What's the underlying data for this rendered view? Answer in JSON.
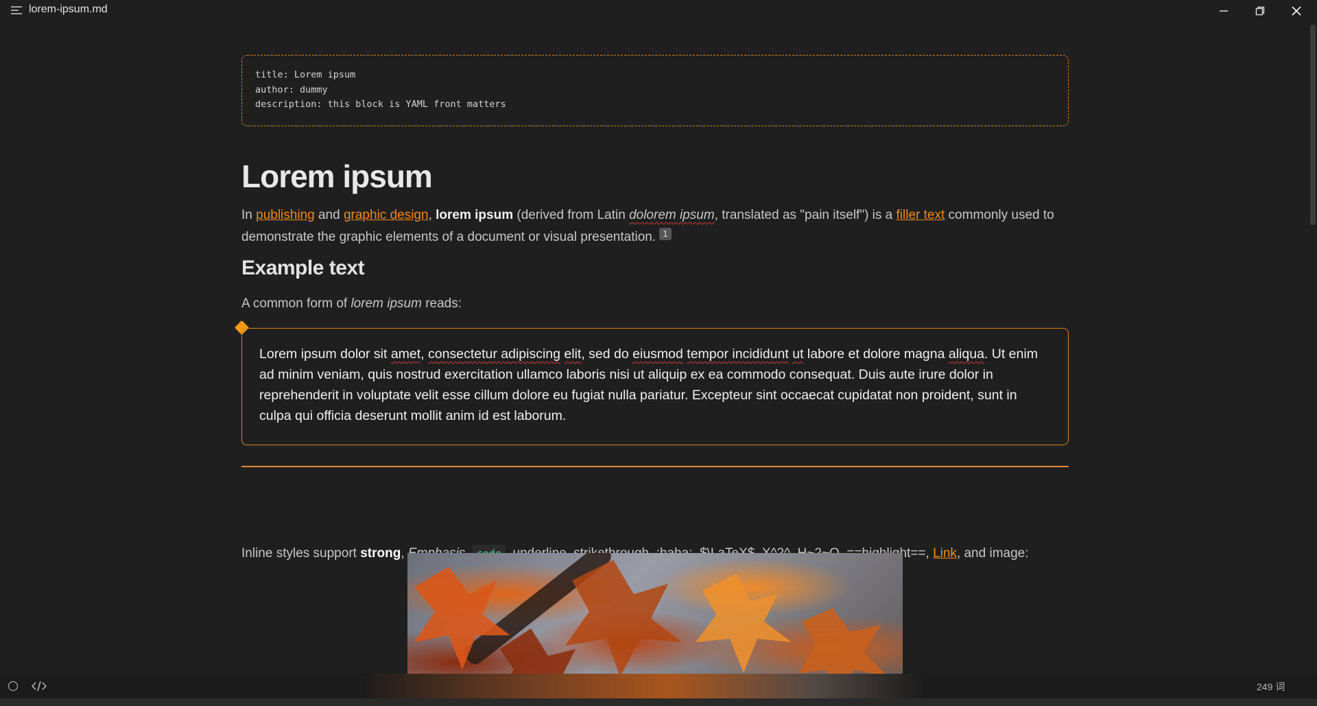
{
  "window": {
    "file_title": "lorem-ipsum.md"
  },
  "frontmatter": {
    "lines": [
      "title: Lorem ipsum",
      "author: dummy",
      "description: this block is YAML front matters"
    ]
  },
  "document": {
    "title": "Lorem ipsum",
    "intro": {
      "t1": "In ",
      "link_publishing": "publishing",
      "t2": " and ",
      "link_graphic_design": "graphic design",
      "t3": ", ",
      "strong": "lorem ipsum",
      "t4": " (derived from Latin ",
      "em": "dolorem ipsum",
      "t5": ", translated as \"pain itself\") is a ",
      "link_filler": "filler text",
      "t6": " commonly used to demonstrate the graphic elements of a document or visual presentation. ",
      "footnote": "1"
    },
    "example_heading": "Example text",
    "example_intro": {
      "t1": "A common form of ",
      "em": "lorem ipsum",
      "t2": " reads:"
    },
    "quote": {
      "w1": "Lorem ipsum dolor sit ",
      "sq1": "amet",
      "w2": ", ",
      "sq2": "consectetur adipiscing",
      "w3": " ",
      "sq3": "elit",
      "w4": ", sed do ",
      "sq4": "eiusmod",
      "w5": " ",
      "sq5": "tempor incididunt",
      "w6": " ",
      "sq6": "ut",
      "w7": " labore et dolore magna ",
      "sq7": "aliqua",
      "w8": ". Ut enim ad minim veniam, quis nostrud exercitation ullamco laboris nisi ut aliquip ex ea commodo consequat. Duis aute irure dolor in reprehenderit in voluptate velit esse cillum dolore eu fugiat nulla pariatur. Excepteur sint occaecat cupidatat non proident, sunt in culpa qui officia deserunt mollit anim id est laborum."
    },
    "inline_styles": {
      "t1": "Inline styles support ",
      "strong": "strong",
      "t2": ", ",
      "em": "Emphasis",
      "t3": ", ",
      "code": "code",
      "t4": ", ",
      "underline": "underline",
      "t5": ", ",
      "strike": "strikethrough",
      "t6": ", :haha:, $\\LaTeX$, X^2^, H~2~O, ==highlight==, ",
      "link": "Link",
      "t7": ", and image:"
    }
  },
  "statusbar": {
    "word_count": "249 词"
  },
  "colors": {
    "accent": "#f08a1a",
    "background": "#1f1f1f",
    "code": "#3ddc84"
  }
}
